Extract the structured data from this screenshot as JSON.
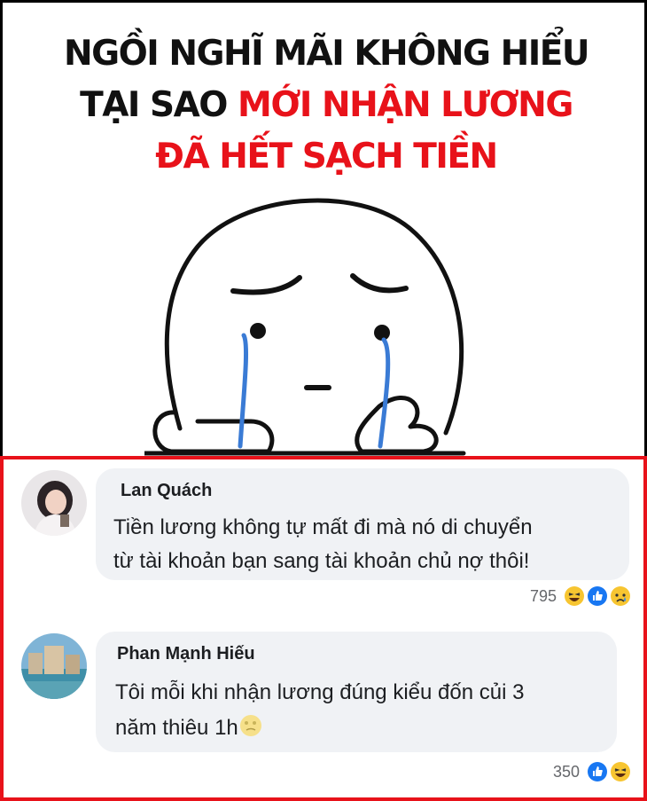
{
  "headline": {
    "line1": "NGỒI NGHĨ MÃI KHÔNG HIỂU",
    "line2_black": "TẠI SAO ",
    "line2_red": "MỚI NHẬN LƯƠNG",
    "line3": "ĐÃ HẾT SẠCH TIỀN"
  },
  "comments": [
    {
      "name": "Lan Quách",
      "line1": "Tiền lương không tự mất đi mà nó di chuyển",
      "line2": "từ tài khoản bạn sang tài khoản chủ nợ thôi!",
      "reaction_count": "795",
      "reactions": [
        "haha-icon",
        "like-icon",
        "sad-icon"
      ]
    },
    {
      "name": "Phan Mạnh Hiếu",
      "line1": "Tôi mỗi khi nhận lương đúng kiểu đốn củi 3",
      "line2": "năm thiêu 1h",
      "reaction_count": "350",
      "reactions": [
        "like-icon",
        "haha-icon"
      ]
    }
  ],
  "colors": {
    "accent_red": "#e8121a",
    "bubble_bg": "#f0f2f5",
    "like_blue": "#1877f2",
    "emoji_yellow": "#f7c531",
    "tear_blue": "#3a7bd5"
  }
}
